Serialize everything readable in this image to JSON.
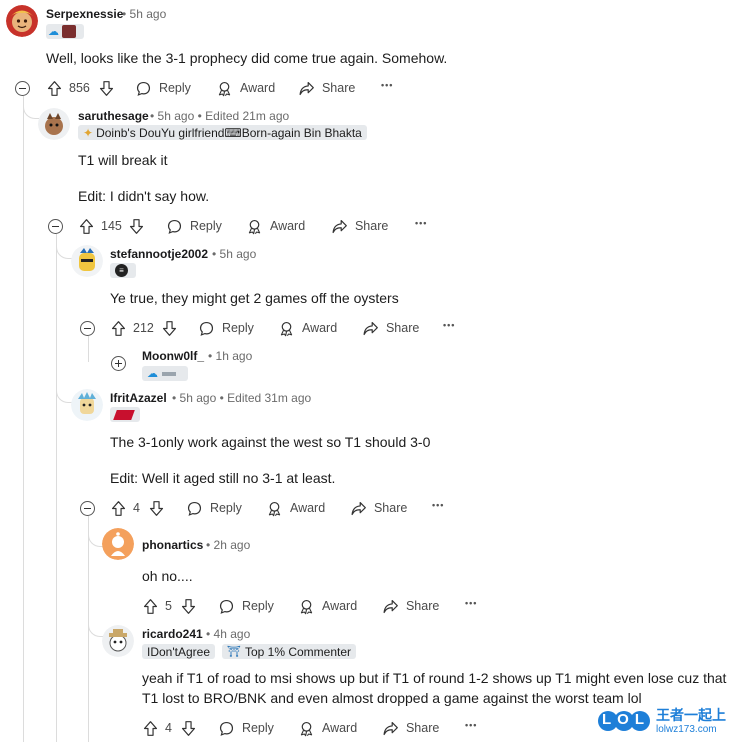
{
  "comments": [
    {
      "id": "c1",
      "user": "Serpexnessie",
      "time": "5h ago",
      "edited": "",
      "flair": "",
      "body": [
        "Well, looks like the 3-1 prophecy did come true again. Somehow."
      ],
      "votes": "856"
    },
    {
      "id": "c2",
      "user": "saruthesage",
      "time": "5h ago",
      "edited": "Edited 21m ago",
      "flair": "Doinb's DouYu girlfriend⌨Born-again Bin Bhakta",
      "body": [
        "T1 will break it",
        "Edit: I didn't say how."
      ],
      "votes": "145"
    },
    {
      "id": "c3",
      "user": "stefannootje2002",
      "time": "5h ago",
      "edited": "",
      "flair": "",
      "body": [
        "Ye true, they might get 2 games off the oysters"
      ],
      "votes": "212"
    },
    {
      "id": "c4",
      "user": "Moonw0lf_",
      "time": "1h ago",
      "edited": "",
      "flair": "",
      "body": [],
      "votes": ""
    },
    {
      "id": "c5",
      "user": "IfritAzazel",
      "time": "5h ago",
      "edited": "Edited 31m ago",
      "flair": "",
      "body": [
        "The 3-1only work against the west so T1 should 3-0",
        "Edit: Well it aged still no 3-1 at least."
      ],
      "votes": "4"
    },
    {
      "id": "c6",
      "user": "phonartics",
      "time": "2h ago",
      "edited": "",
      "flair": "",
      "body": [
        "oh no...."
      ],
      "votes": "5"
    },
    {
      "id": "c7",
      "user": "ricardo241",
      "time": "4h ago",
      "edited": "",
      "flair": "",
      "flair1": "IDon'tAgree",
      "flair2": "Top 1% Commenter",
      "body": [
        "yeah if T1 of road to msi shows up but if T1 of round 1-2 shows up T1 might even lose cuz that",
        "T1 lost to BRO/BNK and even almost dropped a game against the worst team lol"
      ],
      "votes": "4"
    }
  ],
  "actions": {
    "reply": "Reply",
    "award": "Award",
    "share": "Share",
    "more": "•••",
    "sep": "•"
  },
  "watermark": {
    "logo": "LOL",
    "site_cn": "王者一起上",
    "site": "lolwz173.com"
  },
  "colors": {
    "vote_text": "#4a4a4a",
    "meta": "#6b6b6b",
    "thread": "#dcdcdc",
    "watermark": "#1e7fd8"
  },
  "icons": [
    "upvote-icon",
    "downvote-icon",
    "reply-icon",
    "award-icon",
    "share-icon",
    "more-icon",
    "collapse-icon",
    "expand-icon"
  ]
}
